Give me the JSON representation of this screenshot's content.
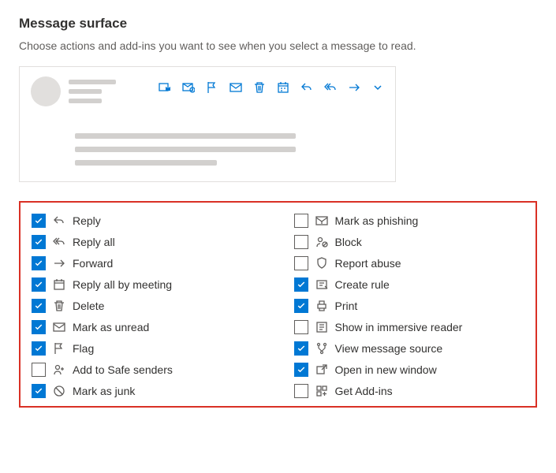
{
  "header": {
    "title": "Message surface",
    "subtitle": "Choose actions and add-ins you want to see when you select a message to read."
  },
  "options": [
    {
      "name": "reply",
      "label": "Reply",
      "checked": true,
      "icon": "reply-icon"
    },
    {
      "name": "reply-all",
      "label": "Reply all",
      "checked": true,
      "icon": "reply-all-icon"
    },
    {
      "name": "forward",
      "label": "Forward",
      "checked": true,
      "icon": "forward-icon"
    },
    {
      "name": "reply-all-by-meeting",
      "label": "Reply all by meeting",
      "checked": true,
      "icon": "calendar-icon"
    },
    {
      "name": "delete",
      "label": "Delete",
      "checked": true,
      "icon": "delete-icon"
    },
    {
      "name": "mark-as-unread",
      "label": "Mark as unread",
      "checked": true,
      "icon": "envelope-icon"
    },
    {
      "name": "flag",
      "label": "Flag",
      "checked": true,
      "icon": "flag-icon"
    },
    {
      "name": "add-to-safe-senders",
      "label": "Add to Safe senders",
      "checked": false,
      "icon": "person-add-icon"
    },
    {
      "name": "mark-as-junk",
      "label": "Mark as junk",
      "checked": true,
      "icon": "junk-icon"
    },
    {
      "name": "mark-as-phishing",
      "label": "Mark as phishing",
      "checked": false,
      "icon": "phishing-icon"
    },
    {
      "name": "block",
      "label": "Block",
      "checked": false,
      "icon": "block-icon"
    },
    {
      "name": "report-abuse",
      "label": "Report abuse",
      "checked": false,
      "icon": "shield-icon"
    },
    {
      "name": "create-rule",
      "label": "Create rule",
      "checked": true,
      "icon": "rule-icon"
    },
    {
      "name": "print",
      "label": "Print",
      "checked": true,
      "icon": "print-icon"
    },
    {
      "name": "show-in-immersive-reader",
      "label": "Show in immersive reader",
      "checked": false,
      "icon": "reader-icon"
    },
    {
      "name": "view-message-source",
      "label": "View message source",
      "checked": true,
      "icon": "source-icon"
    },
    {
      "name": "open-in-new-window",
      "label": "Open in new window",
      "checked": true,
      "icon": "new-window-icon"
    },
    {
      "name": "get-addins",
      "label": "Get Add-ins",
      "checked": false,
      "icon": "addins-icon"
    }
  ]
}
